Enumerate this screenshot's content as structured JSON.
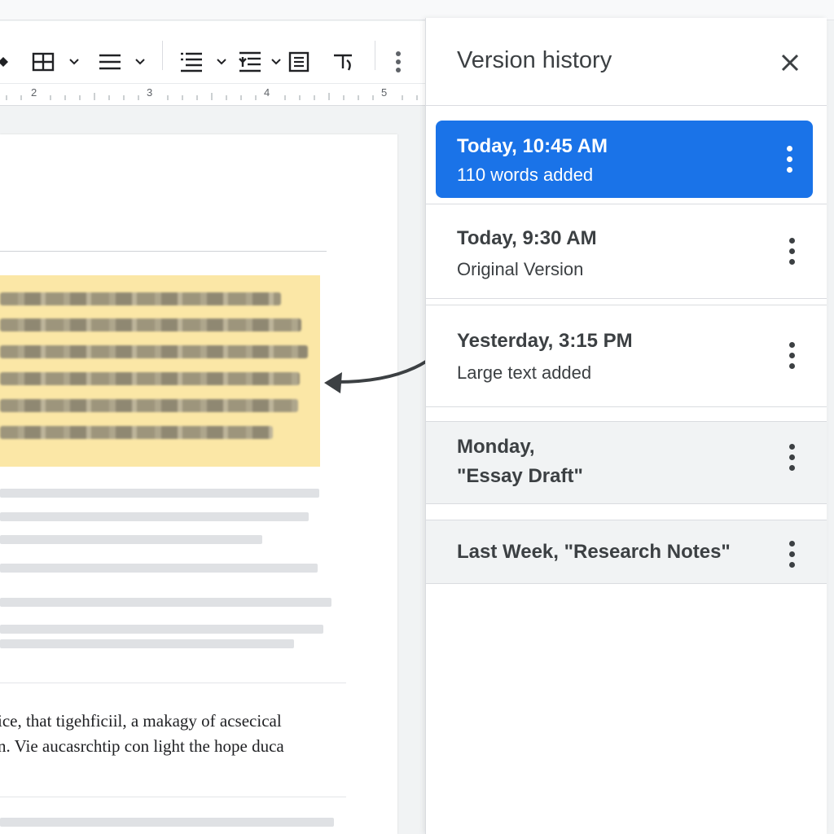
{
  "ruler": {
    "marks": [
      "2",
      "3",
      "4",
      "5"
    ]
  },
  "document": {
    "line1": "ice, that tigehficiil, a makagy of acsecical",
    "line2": "n. Vie aucasrchtip con light the hope duca"
  },
  "panel": {
    "title": "Version history",
    "versions": [
      {
        "title": "Today, 10:45 AM",
        "subtitle": "110 words added"
      },
      {
        "title": "Today, 9:30 AM",
        "subtitle": "Original Version"
      },
      {
        "title": "Yesterday, 3:15 PM",
        "subtitle": "Large text added"
      },
      {
        "title": "Monday,",
        "subtitle": "\"Essay Draft\""
      },
      {
        "title": "Last Week, \"Research Notes\""
      }
    ]
  },
  "colors": {
    "accent": "#1a73e8",
    "highlight": "#fbe7a6"
  },
  "icons": [
    "diamond-icon",
    "table-icon",
    "align-icon",
    "line-spacing-icon",
    "indent-icon",
    "list-icon",
    "clear-format-icon",
    "more-vert-icon",
    "close-icon"
  ]
}
